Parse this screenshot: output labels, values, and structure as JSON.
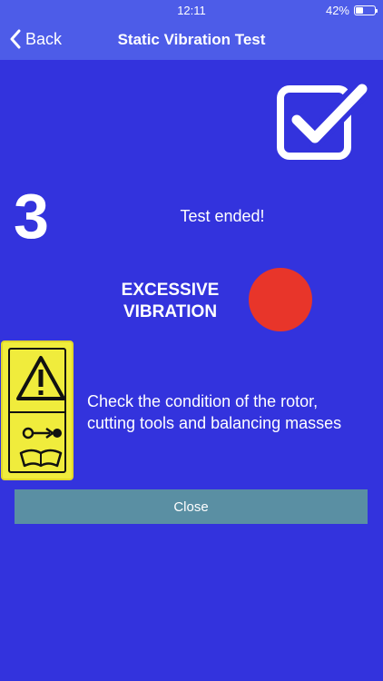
{
  "status_bar": {
    "time": "12:11",
    "battery_percent": "42%",
    "battery_level": 0.42
  },
  "nav": {
    "back_label": "Back",
    "title": "Static Vibration Test"
  },
  "test": {
    "step_number": "3",
    "result_text": "Test ended!",
    "vibration_label": "EXCESSIVE\nVIBRATION",
    "status_color": "#e8352a",
    "instruction": "Check the condition of the rotor,\ncutting tools and balancing masses"
  },
  "actions": {
    "close_label": "Close"
  },
  "icons": {
    "back": "chevron-left-icon",
    "check": "checkbox-checked-icon",
    "warning": "warning-triangle-icon",
    "manual": "read-manual-icon"
  },
  "colors": {
    "background": "#3333dd",
    "bar": "#4d5ce8",
    "button": "#5a8fa3",
    "warning_sign": "#f0ec3c"
  }
}
